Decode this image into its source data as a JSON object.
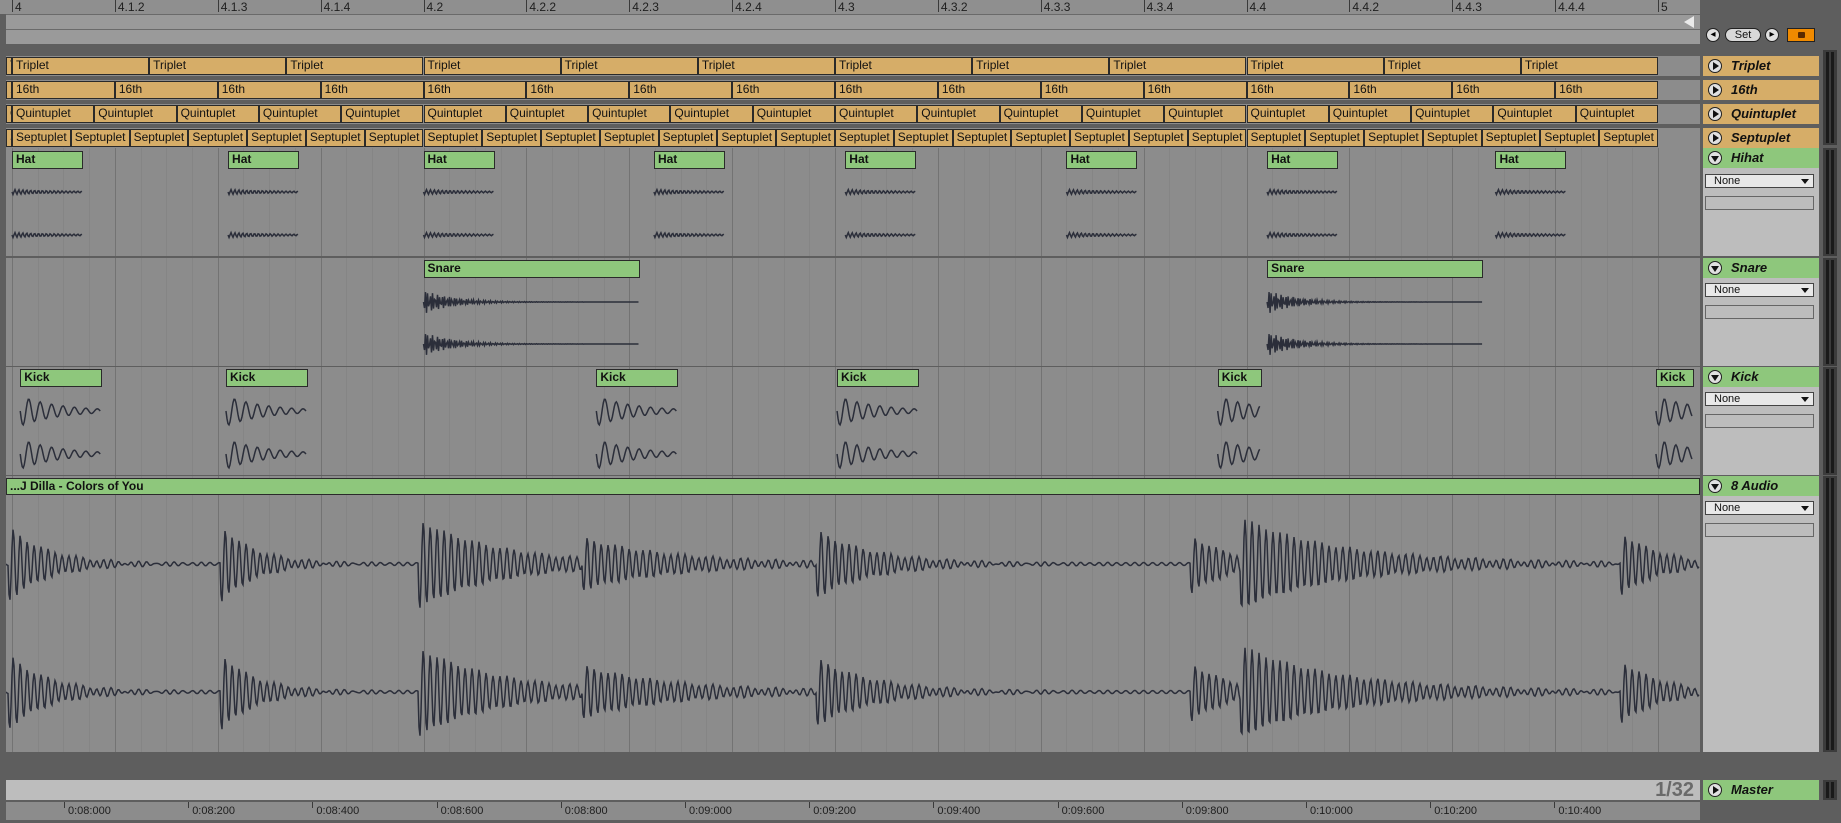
{
  "top_ruler": {
    "labels": [
      "4",
      "4.1.2",
      "4.1.3",
      "4.1.4",
      "4.2",
      "4.2.2",
      "4.2.3",
      "4.2.4",
      "4.3",
      "4.3.2",
      "4.3.3",
      "4.3.4",
      "4.4",
      "4.4.2",
      "4.4.3",
      "4.4.4",
      "5"
    ]
  },
  "transport": {
    "set_label": "Set"
  },
  "grid_tracks": [
    {
      "name": "Triplet",
      "clip_label": "Triplet",
      "count": 12
    },
    {
      "name": "16th",
      "clip_label": "16th",
      "count": 16
    },
    {
      "name": "Quintuplet",
      "clip_label": "Quintuplet",
      "count": 20
    },
    {
      "name": "Septuplet",
      "clip_label": "Septuplet",
      "count": 28
    }
  ],
  "drum_tracks": [
    {
      "name": "Hihat",
      "clip_label": "Hat",
      "input": "None"
    },
    {
      "name": "Snare",
      "clip_label": "Snare",
      "input": "None"
    },
    {
      "name": "Kick",
      "clip_label": "Kick",
      "input": "None"
    }
  ],
  "audio_track": {
    "name": "8 Audio",
    "clip_label": "...J Dilla - Colors of You",
    "input": "None"
  },
  "master": {
    "name": "Master",
    "zoom": "1/32"
  },
  "bottom_ruler": {
    "labels": [
      "0:08:000",
      "0:08:200",
      "0:08:400",
      "0:08:600",
      "0:08:800",
      "0:09:000",
      "0:09:200",
      "0:09:400",
      "0:09:600",
      "0:09:800",
      "0:10:000",
      "0:10:200",
      "0:10:400"
    ]
  },
  "colors": {
    "grid_clip": "#d6ad68",
    "drum_clip": "#8ec77c",
    "waveform": "#2b2e3a",
    "arm": "#f08a00"
  }
}
